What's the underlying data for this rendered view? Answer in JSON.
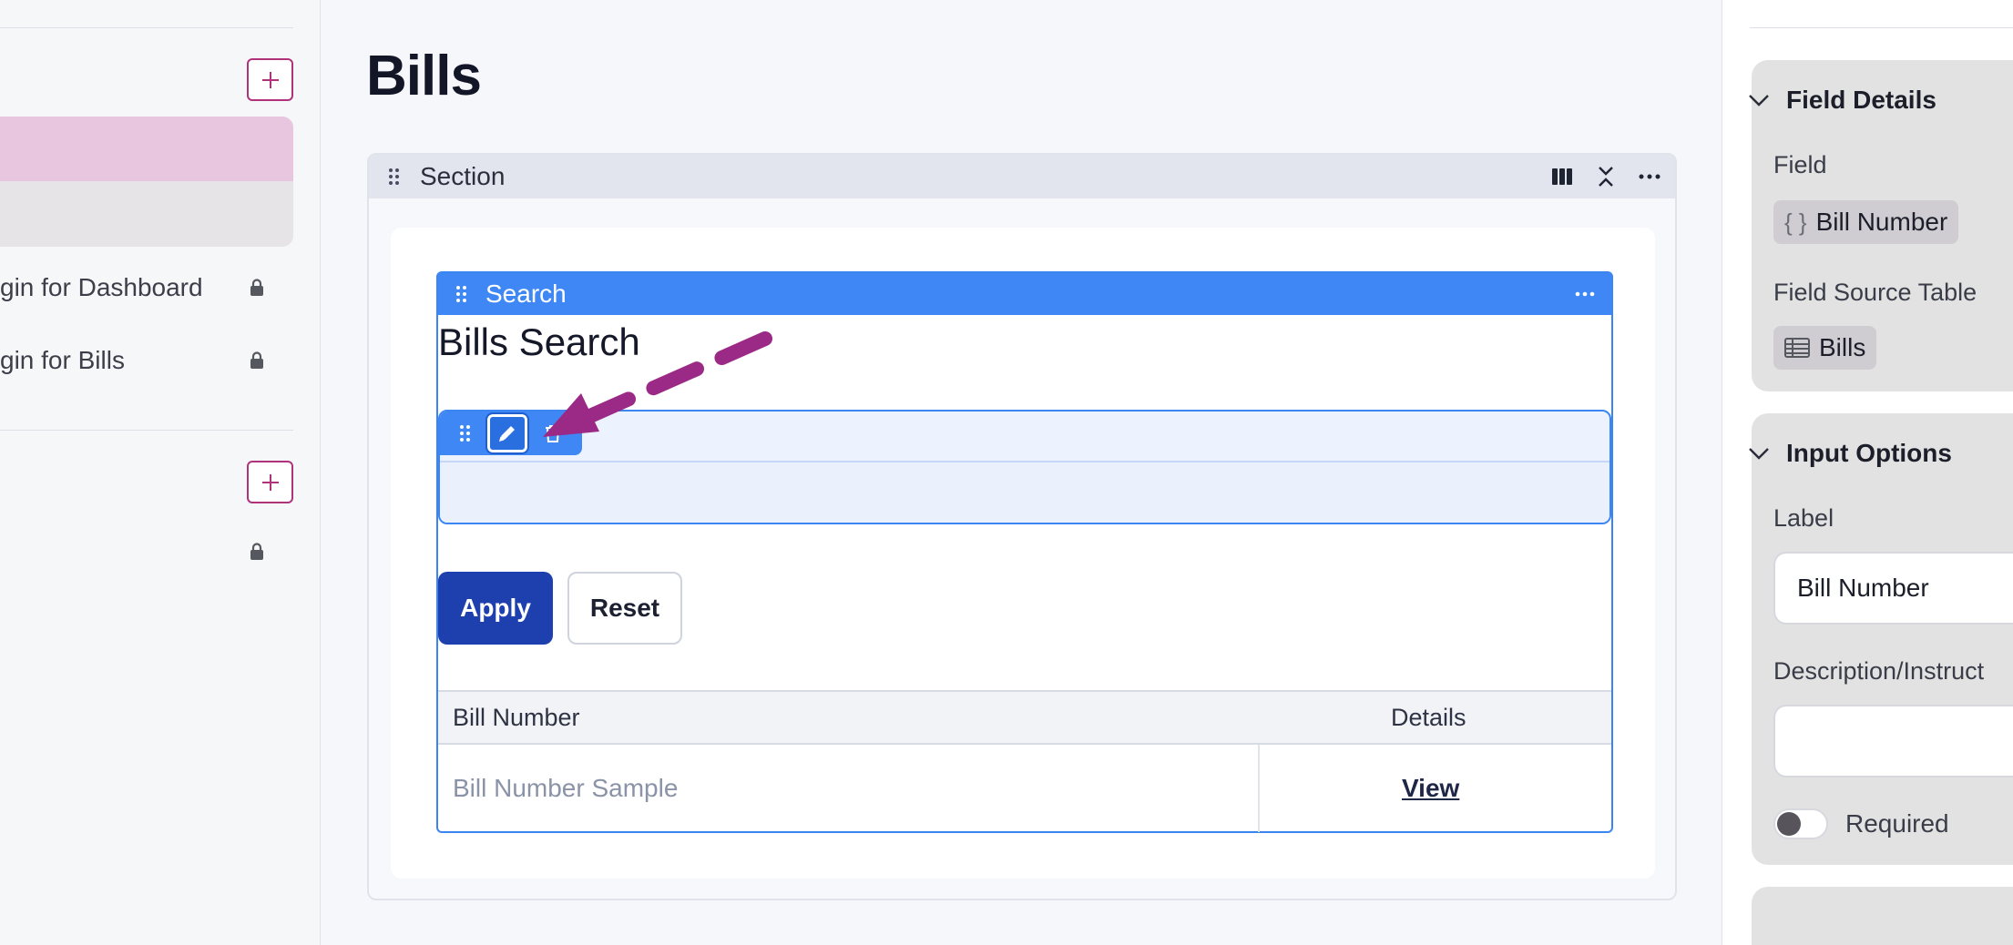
{
  "page": {
    "title": "Bills"
  },
  "sidebar": {
    "items": [
      {
        "label": "gin for Dashboard"
      },
      {
        "label": "gin for Bills"
      }
    ]
  },
  "section": {
    "title": "Section"
  },
  "search_block": {
    "header_title": "Search",
    "heading": "Bills Search",
    "apply_label": "Apply",
    "reset_label": "Reset",
    "table": {
      "columns": [
        "Bill Number",
        "Details"
      ],
      "rows": [
        {
          "bill_number": "Bill Number Sample",
          "details": "View"
        }
      ]
    }
  },
  "right_panel": {
    "field_details": {
      "heading": "Field Details",
      "field_label": "Field",
      "field_value": "Bill Number",
      "source_label": "Field Source Table",
      "source_value": "Bills"
    },
    "input_options": {
      "heading": "Input Options",
      "label_label": "Label",
      "label_value": "Bill Number",
      "description_label": "Description/Instruct",
      "description_value": "",
      "required_label": "Required",
      "required": false
    }
  },
  "colors": {
    "accent_blue": "#3e87f4",
    "apply_button": "#1e3fae",
    "sidebar_active": "#e9c6e0",
    "plus_border": "#b0327a",
    "annotation_arrow": "#9b2a86"
  }
}
